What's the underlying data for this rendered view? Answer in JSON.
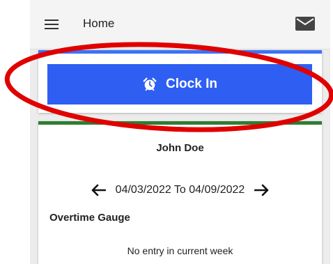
{
  "appbar": {
    "title": "Home",
    "menu_icon": "hamburger-menu-icon",
    "mail_icon": "mail-icon"
  },
  "clock_in": {
    "label": "Clock In",
    "icon": "alarm-clock-icon",
    "accent_color": "#3d73f5",
    "button_color": "#2e5ff2"
  },
  "summary": {
    "accent_color": "#2e7d32",
    "user_name": "John Doe",
    "week_range": "04/03/2022 To 04/09/2022",
    "prev_icon": "arrow-left-icon",
    "next_icon": "arrow-right-icon",
    "gauge_title": "Overtime Gauge",
    "gauge_status": "No entry in current week"
  },
  "annotation": {
    "shape": "ellipse",
    "color": "#e00000"
  }
}
